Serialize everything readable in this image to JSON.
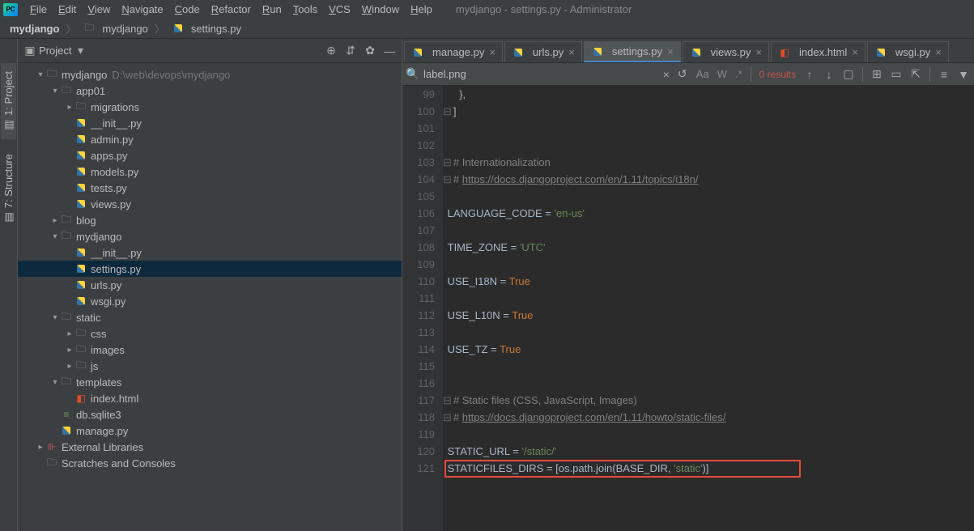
{
  "title": "mydjango - settings.py - Administrator",
  "menu": [
    "File",
    "Edit",
    "View",
    "Navigate",
    "Code",
    "Refactor",
    "Run",
    "Tools",
    "VCS",
    "Window",
    "Help"
  ],
  "breadcrumb": [
    {
      "label": "mydjango",
      "bold": true
    },
    {
      "label": "mydjango",
      "icon": "folder"
    },
    {
      "label": "settings.py",
      "icon": "py"
    }
  ],
  "sidebar_vert": {
    "project_label": "1: Project",
    "structure_label": "7: Structure"
  },
  "project_panel": {
    "title": "Project",
    "root": {
      "label": "mydjango",
      "path": "D:\\web\\devops\\mydjango"
    },
    "tree": [
      {
        "d": 0,
        "chev": "down",
        "icon": "folder",
        "label": "mydjango",
        "path": "D:\\web\\devops\\mydjango"
      },
      {
        "d": 1,
        "chev": "down",
        "icon": "folder",
        "label": "app01"
      },
      {
        "d": 2,
        "chev": "right",
        "icon": "folder",
        "label": "migrations"
      },
      {
        "d": 2,
        "icon": "py",
        "label": "__init__.py"
      },
      {
        "d": 2,
        "icon": "py",
        "label": "admin.py"
      },
      {
        "d": 2,
        "icon": "py",
        "label": "apps.py"
      },
      {
        "d": 2,
        "icon": "py",
        "label": "models.py"
      },
      {
        "d": 2,
        "icon": "py",
        "label": "tests.py"
      },
      {
        "d": 2,
        "icon": "py",
        "label": "views.py"
      },
      {
        "d": 1,
        "chev": "right",
        "icon": "folder",
        "label": "blog"
      },
      {
        "d": 1,
        "chev": "down",
        "icon": "folder",
        "label": "mydjango"
      },
      {
        "d": 2,
        "icon": "py",
        "label": "__init__.py"
      },
      {
        "d": 2,
        "icon": "py",
        "label": "settings.py",
        "selected": true
      },
      {
        "d": 2,
        "icon": "py",
        "label": "urls.py"
      },
      {
        "d": 2,
        "icon": "py",
        "label": "wsgi.py"
      },
      {
        "d": 1,
        "chev": "down",
        "icon": "folder",
        "label": "static"
      },
      {
        "d": 2,
        "chev": "right",
        "icon": "folder",
        "label": "css"
      },
      {
        "d": 2,
        "chev": "right",
        "icon": "folder",
        "label": "images"
      },
      {
        "d": 2,
        "chev": "right",
        "icon": "folder",
        "label": "js"
      },
      {
        "d": 1,
        "chev": "down",
        "icon": "folder",
        "label": "templates"
      },
      {
        "d": 2,
        "icon": "html",
        "label": "index.html"
      },
      {
        "d": 1,
        "icon": "db",
        "label": "db.sqlite3"
      },
      {
        "d": 1,
        "icon": "py",
        "label": "manage.py"
      },
      {
        "d": 0,
        "chev": "right",
        "icon": "lib",
        "label": "External Libraries"
      },
      {
        "d": 0,
        "icon": "folder",
        "label": "Scratches and Consoles"
      }
    ]
  },
  "tabs": [
    {
      "label": "manage.py",
      "icon": "py"
    },
    {
      "label": "urls.py",
      "icon": "py"
    },
    {
      "label": "settings.py",
      "icon": "py",
      "active": true
    },
    {
      "label": "views.py",
      "icon": "py"
    },
    {
      "label": "index.html",
      "icon": "html"
    },
    {
      "label": "wsgi.py",
      "icon": "py"
    }
  ],
  "search": {
    "value": "label.png",
    "results": "0 results",
    "opts": [
      "Aa",
      "W",
      ".*"
    ]
  },
  "code": {
    "start": 99,
    "lines": [
      {
        "n": 99,
        "raw": "    },"
      },
      {
        "n": 100,
        "raw": "]",
        "fold": true
      },
      {
        "n": 101,
        "raw": ""
      },
      {
        "n": 102,
        "raw": ""
      },
      {
        "n": 103,
        "raw": "# Internationalization",
        "type": "comment",
        "fold": true
      },
      {
        "n": 104,
        "raw_parts": [
          "# ",
          "https://docs.djangoproject.com/en/1.11/topics/i18n/"
        ],
        "type": "url",
        "fold": true
      },
      {
        "n": 105,
        "raw": ""
      },
      {
        "n": 106,
        "raw_parts": [
          "LANGUAGE_CODE",
          " = ",
          "'en-us'"
        ],
        "types": [
          "var",
          "op",
          "str"
        ]
      },
      {
        "n": 107,
        "raw": ""
      },
      {
        "n": 108,
        "raw_parts": [
          "TIME_ZONE",
          " = ",
          "'UTC'"
        ],
        "types": [
          "var",
          "op",
          "str"
        ]
      },
      {
        "n": 109,
        "raw": ""
      },
      {
        "n": 110,
        "raw_parts": [
          "USE_I18N",
          " = ",
          "True"
        ],
        "types": [
          "var",
          "op",
          "kw"
        ]
      },
      {
        "n": 111,
        "raw": ""
      },
      {
        "n": 112,
        "raw_parts": [
          "USE_L10N",
          " = ",
          "True"
        ],
        "types": [
          "var",
          "op",
          "kw"
        ]
      },
      {
        "n": 113,
        "raw": ""
      },
      {
        "n": 114,
        "raw_parts": [
          "USE_TZ",
          " = ",
          "True"
        ],
        "types": [
          "var",
          "op",
          "kw"
        ]
      },
      {
        "n": 115,
        "raw": ""
      },
      {
        "n": 116,
        "raw": ""
      },
      {
        "n": 117,
        "raw": "# Static files (CSS, JavaScript, Images)",
        "type": "comment",
        "fold": true
      },
      {
        "n": 118,
        "raw_parts": [
          "# ",
          "https://docs.djangoproject.com/en/1.11/howto/static-files/"
        ],
        "type": "url",
        "fold": true
      },
      {
        "n": 119,
        "raw": ""
      },
      {
        "n": 120,
        "raw_parts": [
          "STATIC_URL",
          " = ",
          "'/static/'"
        ],
        "types": [
          "var",
          "op",
          "str"
        ]
      },
      {
        "n": 121,
        "raw_parts": [
          "STATICFILES_DIRS",
          " = [os.path.join(BASE_DIR, ",
          "'static'",
          ")]"
        ],
        "types": [
          "var",
          "op",
          "str",
          "op"
        ],
        "hl": true
      }
    ]
  }
}
